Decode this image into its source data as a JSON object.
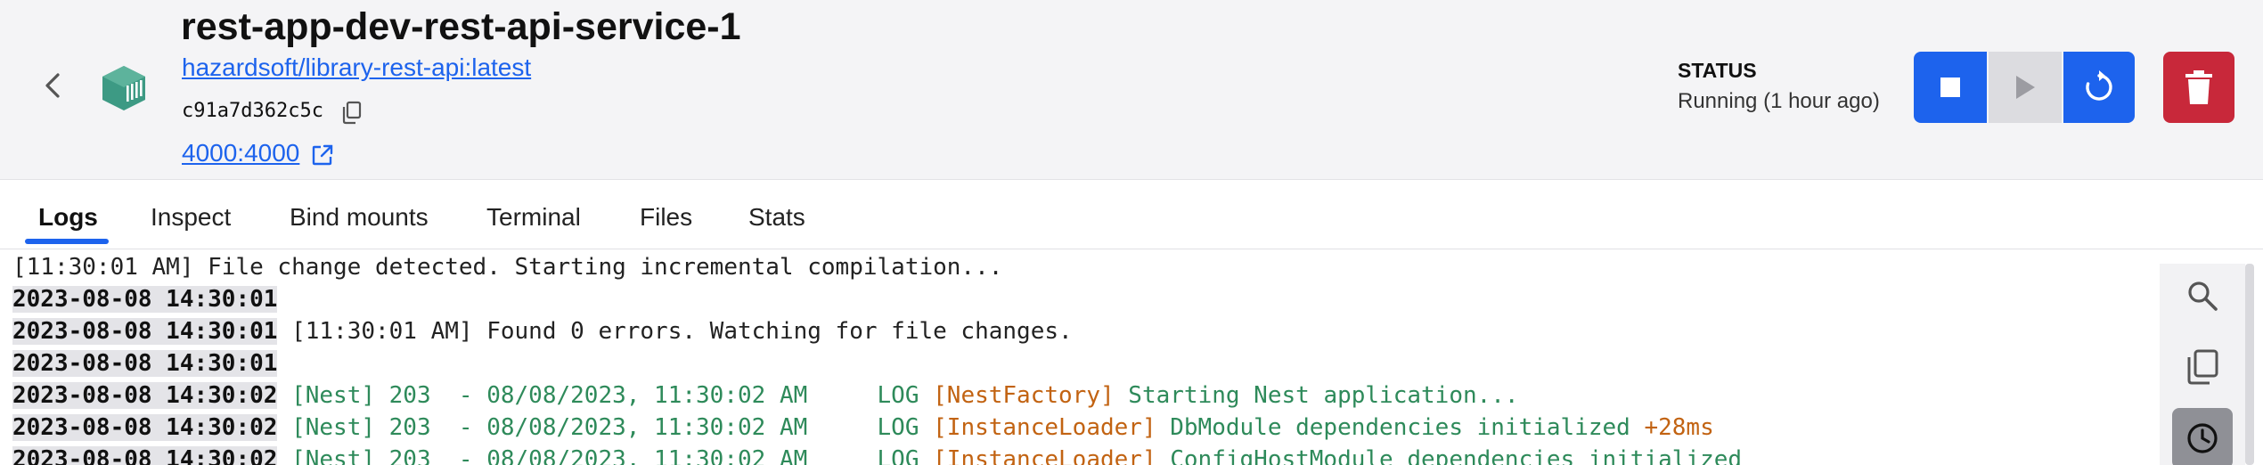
{
  "header": {
    "container_name": "rest-app-dev-rest-api-service-1",
    "image": "hazardsoft/library-rest-api:latest",
    "container_id": "c91a7d362c5c",
    "port": "4000:4000",
    "status_label": "STATUS",
    "status_value": "Running (1 hour ago)",
    "icons": {
      "back": "chevron-left-icon",
      "container": "container-icon",
      "copy": "copy-icon",
      "external": "external-link-icon"
    }
  },
  "actions": {
    "stop": "stop-icon",
    "start": "play-icon",
    "restart": "restart-icon",
    "delete": "trash-icon"
  },
  "tabs": [
    {
      "label": "Logs",
      "active": true
    },
    {
      "label": "Inspect",
      "active": false
    },
    {
      "label": "Bind mounts",
      "active": false
    },
    {
      "label": "Terminal",
      "active": false
    },
    {
      "label": "Files",
      "active": false
    },
    {
      "label": "Stats",
      "active": false
    }
  ],
  "logs": [
    {
      "ts": "",
      "parts": [
        {
          "t": "[11:30:01 AM] File change detected. Starting incremental compilation...",
          "c": "plain"
        }
      ]
    },
    {
      "ts": "2023-08-08 14:30:01",
      "parts": []
    },
    {
      "ts": "2023-08-08 14:30:01",
      "parts": [
        {
          "t": " [11:30:01 AM] Found 0 errors. Watching for file changes.",
          "c": "plain"
        }
      ]
    },
    {
      "ts": "2023-08-08 14:30:01",
      "parts": []
    },
    {
      "ts": "2023-08-08 14:30:02",
      "parts": [
        {
          "t": " [Nest] 203  - 08/08/2023, 11:30:02 AM     LOG ",
          "c": "green"
        },
        {
          "t": "[NestFactory] ",
          "c": "orange"
        },
        {
          "t": "Starting Nest application...",
          "c": "green"
        }
      ]
    },
    {
      "ts": "2023-08-08 14:30:02",
      "parts": [
        {
          "t": " [Nest] 203  - 08/08/2023, 11:30:02 AM     LOG ",
          "c": "green"
        },
        {
          "t": "[InstanceLoader] ",
          "c": "orange"
        },
        {
          "t": "DbModule dependencies initialized ",
          "c": "green"
        },
        {
          "t": "+28ms",
          "c": "orange"
        }
      ]
    },
    {
      "ts": "2023-08-08 14:30:02",
      "parts": [
        {
          "t": " [Nest] 203  - 08/08/2023, 11:30:02 AM     LOG ",
          "c": "green"
        },
        {
          "t": "[InstanceLoader] ",
          "c": "orange"
        },
        {
          "t": "ConfigHostModule dependencies initialized",
          "c": "green"
        }
      ]
    }
  ],
  "log_tools": {
    "search": "search-icon",
    "copy": "copy-icon",
    "timestamps": "clock-icon"
  },
  "colors": {
    "accent": "#1d63ed",
    "danger": "#c8283a",
    "log_green": "#2e8a5a",
    "log_orange": "#c26312"
  }
}
